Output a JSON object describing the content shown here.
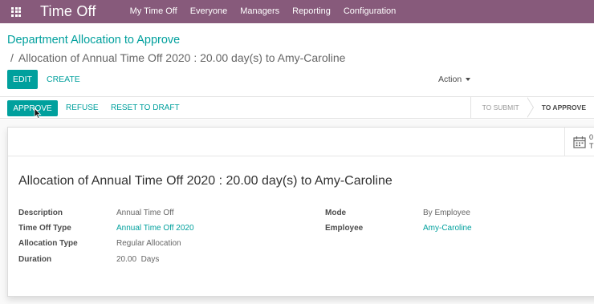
{
  "navbar": {
    "app_title": "Time Off",
    "menu": [
      "My Time Off",
      "Everyone",
      "Managers",
      "Reporting",
      "Configuration"
    ],
    "bg_color": "#875a7b"
  },
  "breadcrumb": {
    "parent": "Department Allocation to Approve",
    "separator": "/",
    "current": "Allocation of Annual Time Off 2020 : 20.00 day(s) to Amy-Caroline"
  },
  "controls": {
    "edit_label": "EDIT",
    "create_label": "CREATE",
    "action_label": "Action"
  },
  "statusbar": {
    "approve_label": "APPROVE",
    "refuse_label": "REFUSE",
    "reset_label": "RESET TO DRAFT",
    "stages": [
      "TO SUBMIT",
      "TO APPROVE"
    ],
    "active_stage": "TO APPROVE"
  },
  "smart_button": {
    "icon": "calendar-icon",
    "value": "0",
    "label": "T"
  },
  "record": {
    "title": "Allocation of Annual Time Off 2020 : 20.00 day(s) to Amy-Caroline",
    "left_fields": [
      {
        "label": "Description",
        "value": "Annual Time Off"
      },
      {
        "label": "Time Off Type",
        "value": "Annual Time Off 2020"
      },
      {
        "label": "Allocation Type",
        "value": "Regular Allocation"
      },
      {
        "label": "Duration",
        "value": "20.00  Days"
      }
    ],
    "right_fields": [
      {
        "label": "Mode",
        "value": "By Employee"
      },
      {
        "label": "Employee",
        "value": "Amy-Caroline"
      }
    ]
  },
  "colors": {
    "accent": "#00A09D",
    "brand": "#875a7b"
  }
}
